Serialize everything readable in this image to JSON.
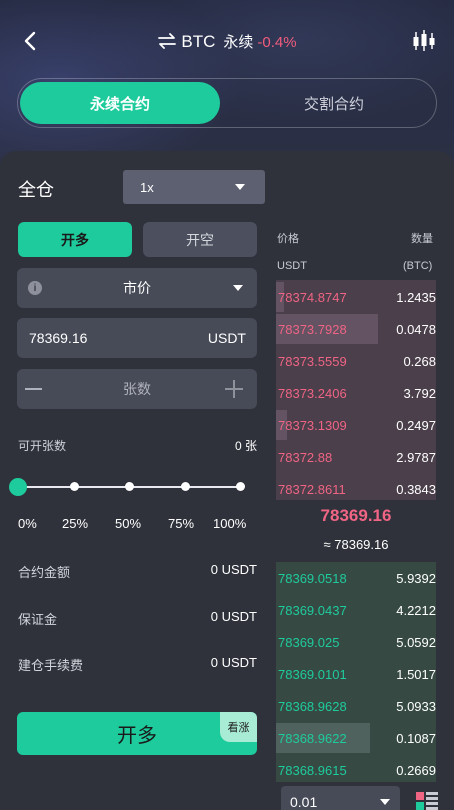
{
  "header": {
    "symbol": "BTC",
    "contract_type": "永续",
    "change": "-0.4%"
  },
  "tabs": [
    {
      "label": "永续合约",
      "active": true
    },
    {
      "label": "交割合约",
      "active": false
    }
  ],
  "form": {
    "margin_mode": "全仓",
    "leverage": "1x",
    "long_label": "开多",
    "short_label": "开空",
    "order_type": "市价",
    "price_value": "78369.16",
    "price_unit": "USDT",
    "qty_placeholder": "张数",
    "available_label": "可开张数",
    "available_value": "0 张",
    "slider_percent": 0,
    "percents": [
      "0%",
      "25%",
      "50%",
      "75%",
      "100%"
    ],
    "contract_amount_label": "合约金额",
    "contract_amount_value": "0 USDT",
    "margin_label": "保证金",
    "margin_value": "0 USDT",
    "fee_label": "建仓手续费",
    "fee_value": "0 USDT",
    "submit_label": "开多",
    "submit_tag": "看涨"
  },
  "orderbook": {
    "price_header": "价格",
    "qty_header": "数量",
    "price_unit": "USDT",
    "qty_unit": "(BTC)",
    "asks": [
      {
        "price": "78374.8747",
        "qty": "1.2435",
        "depth": 0.05
      },
      {
        "price": "78373.7928",
        "qty": "0.0478",
        "depth": 0.64
      },
      {
        "price": "78373.5559",
        "qty": "0.268",
        "depth": 0.0
      },
      {
        "price": "78373.2406",
        "qty": "3.792",
        "depth": 0.0
      },
      {
        "price": "78373.1309",
        "qty": "0.2497",
        "depth": 0.07
      },
      {
        "price": "78372.88",
        "qty": "2.9787",
        "depth": 0.0
      },
      {
        "price": "78372.8611",
        "qty": "0.3843",
        "depth": 0.0
      }
    ],
    "mid_price": "78369.16",
    "mid_approx": "≈ 78369.16",
    "bids": [
      {
        "price": "78369.0518",
        "qty": "5.9392",
        "depth": 0.0
      },
      {
        "price": "78369.0437",
        "qty": "4.2212",
        "depth": 0.0
      },
      {
        "price": "78369.025",
        "qty": "5.0592",
        "depth": 0.0
      },
      {
        "price": "78369.0101",
        "qty": "1.5017",
        "depth": 0.0
      },
      {
        "price": "78368.9628",
        "qty": "5.0933",
        "depth": 0.0
      },
      {
        "price": "78368.9622",
        "qty": "0.1087",
        "depth": 0.59
      },
      {
        "price": "78368.9615",
        "qty": "0.2669",
        "depth": 0.0
      }
    ],
    "precision": "0.01"
  },
  "colors": {
    "accent": "#1ecb9c",
    "down": "#f06484"
  }
}
